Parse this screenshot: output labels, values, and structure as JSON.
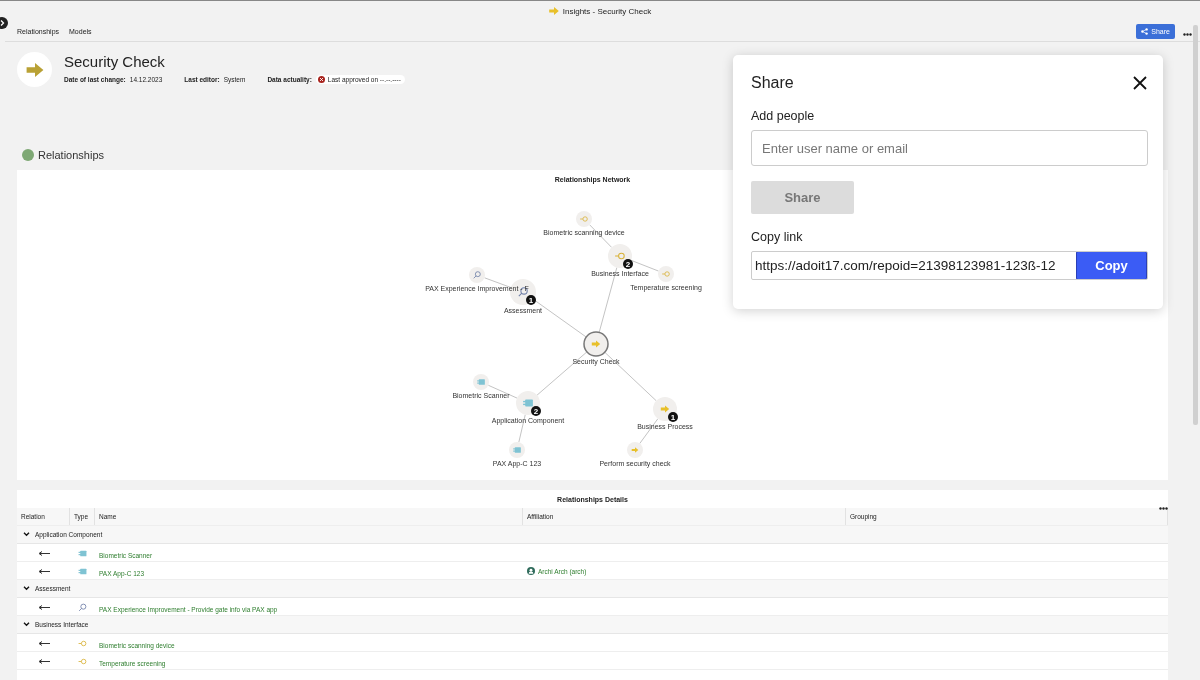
{
  "window": {
    "title": "Insights - Security Check"
  },
  "nav": [
    "Relationships",
    "Models"
  ],
  "toolbar": {
    "share_label": "Share"
  },
  "header": {
    "title": "Security Check",
    "meta": [
      {
        "label": "Date of last change:",
        "value": "14.12.2023"
      },
      {
        "label": "Last editor:",
        "value": "System"
      }
    ],
    "actuality": {
      "label": "Data actuality:",
      "value": "Last approved on --.--.----"
    }
  },
  "section": {
    "title": "Relationships"
  },
  "network": {
    "title": "Relationships Network",
    "root": {
      "label": "Security Check",
      "kind": "process",
      "children": [
        {
          "label": "Assessment",
          "kind": "assessment",
          "badge": "1",
          "children": [
            {
              "label": "PAX Experience Improvement - F",
              "kind": "assessment"
            }
          ]
        },
        {
          "label": "Business Interface",
          "kind": "interface",
          "badge": "2",
          "children": [
            {
              "label": "Biometric scanning device",
              "kind": "interface"
            },
            {
              "label": "Temperature screening",
              "kind": "interface"
            }
          ]
        },
        {
          "label": "Application Component",
          "kind": "component",
          "badge": "2",
          "children": [
            {
              "label": "Biometric Scanner",
              "kind": "component"
            },
            {
              "label": "PAX App-C 123",
              "kind": "component"
            }
          ]
        },
        {
          "label": "Business Process",
          "kind": "process",
          "badge": "1",
          "children": [
            {
              "label": "Perform security check",
              "kind": "process"
            }
          ]
        }
      ]
    }
  },
  "details": {
    "title": "Relationships Details",
    "columns": [
      "Relation",
      "Type",
      "Name",
      "Affiliation",
      "Grouping"
    ],
    "groups": [
      {
        "label": "Application Component",
        "expanded": true,
        "rows": [
          {
            "kind": "component",
            "name": "Biometric Scanner"
          },
          {
            "kind": "component",
            "name": "PAX App-C 123",
            "affiliation": "Archi Arch (arch)"
          }
        ]
      },
      {
        "label": "Assessment",
        "expanded": true,
        "rows": [
          {
            "kind": "assessment",
            "name": "PAX Experience Improvement - Provide gate info via PAX app"
          }
        ]
      },
      {
        "label": "Business Interface",
        "expanded": true,
        "rows": [
          {
            "kind": "interface",
            "name": "Biometric scanning device"
          },
          {
            "kind": "interface",
            "name": "Temperature screening"
          }
        ]
      }
    ]
  },
  "dialog": {
    "title": "Share",
    "add_people_label": "Add people",
    "input": {
      "placeholder": "Enter user name or email"
    },
    "share_button": {
      "label": "Share",
      "disabled": true
    },
    "copy_link_label": "Copy link",
    "link": {
      "value": "https://adoit17.com/repoid=21398123981-123ß-12"
    },
    "copy_button": "Copy"
  }
}
